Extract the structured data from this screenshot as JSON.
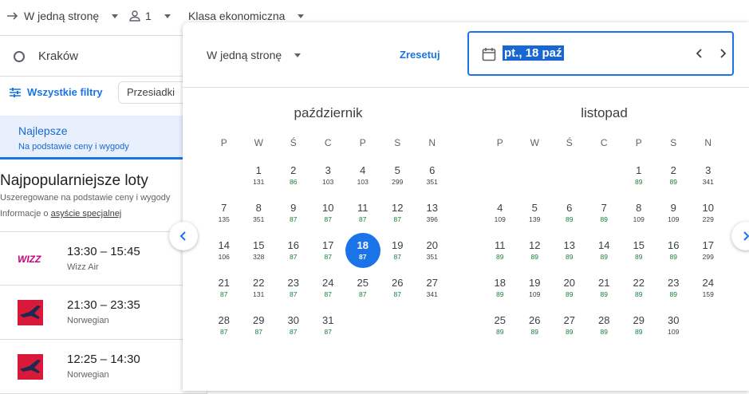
{
  "topbar": {
    "trip_type": "W jedną stronę",
    "passengers": "1",
    "cabin_class": "Klasa ekonomiczna"
  },
  "search": {
    "origin": "Kraków"
  },
  "filters": {
    "all_filters_label": "Wszystkie filtry",
    "stops_chip": "Przesiadki"
  },
  "sort_tab": {
    "title": "Najlepsze",
    "subtitle": "Na podstawie ceny i wygody"
  },
  "popular": {
    "title": "Najpopularniejsze loty",
    "subtitle": "Uszeregowane na podstawie ceny i wygody",
    "info_prefix": "Informacje o ",
    "info_link": "asyście specjalnej"
  },
  "flights": [
    {
      "time": "13:30 – 15:45",
      "airline": "Wizz Air",
      "logo": "wizz-logo"
    },
    {
      "time": "21:30 – 23:35",
      "airline": "Norwegian",
      "logo": "norwegian-logo"
    },
    {
      "time": "12:25 – 14:30",
      "airline": "Norwegian",
      "logo": "norwegian-logo"
    }
  ],
  "date_panel": {
    "trip_type": "W jedną stronę",
    "reset_label": "Zresetuj",
    "date_value": "pt., 18 paź",
    "weekdays": [
      "P",
      "W",
      "Ś",
      "C",
      "P",
      "S",
      "N"
    ],
    "months": [
      {
        "name": "październik",
        "offset": 1,
        "days": [
          {
            "d": "1",
            "p": "131"
          },
          {
            "d": "2",
            "p": "86",
            "low": true
          },
          {
            "d": "3",
            "p": "103"
          },
          {
            "d": "4",
            "p": "103"
          },
          {
            "d": "5",
            "p": "299"
          },
          {
            "d": "6",
            "p": "351"
          },
          {
            "d": "7",
            "p": "135"
          },
          {
            "d": "8",
            "p": "351"
          },
          {
            "d": "9",
            "p": "87",
            "low": true
          },
          {
            "d": "10",
            "p": "87",
            "low": true
          },
          {
            "d": "11",
            "p": "87",
            "low": true
          },
          {
            "d": "12",
            "p": "87",
            "low": true
          },
          {
            "d": "13",
            "p": "396"
          },
          {
            "d": "14",
            "p": "106"
          },
          {
            "d": "15",
            "p": "328"
          },
          {
            "d": "16",
            "p": "87",
            "low": true
          },
          {
            "d": "17",
            "p": "87",
            "low": true
          },
          {
            "d": "18",
            "p": "87",
            "selected": true
          },
          {
            "d": "19",
            "p": "87",
            "low": true
          },
          {
            "d": "20",
            "p": "351"
          },
          {
            "d": "21",
            "p": "87",
            "low": true
          },
          {
            "d": "22",
            "p": "131"
          },
          {
            "d": "23",
            "p": "87",
            "low": true
          },
          {
            "d": "24",
            "p": "87",
            "low": true
          },
          {
            "d": "25",
            "p": "87",
            "low": true
          },
          {
            "d": "26",
            "p": "87",
            "low": true
          },
          {
            "d": "27",
            "p": "341"
          },
          {
            "d": "28",
            "p": "87",
            "low": true
          },
          {
            "d": "29",
            "p": "87",
            "low": true
          },
          {
            "d": "30",
            "p": "87",
            "low": true
          },
          {
            "d": "31",
            "p": "87",
            "low": true
          }
        ]
      },
      {
        "name": "listopad",
        "offset": 4,
        "days": [
          {
            "d": "1",
            "p": "89",
            "low": true
          },
          {
            "d": "2",
            "p": "89",
            "low": true
          },
          {
            "d": "3",
            "p": "341"
          },
          {
            "d": "4",
            "p": "109"
          },
          {
            "d": "5",
            "p": "139"
          },
          {
            "d": "6",
            "p": "89",
            "low": true
          },
          {
            "d": "7",
            "p": "89",
            "low": true
          },
          {
            "d": "8",
            "p": "109"
          },
          {
            "d": "9",
            "p": "109"
          },
          {
            "d": "10",
            "p": "229"
          },
          {
            "d": "11",
            "p": "89",
            "low": true
          },
          {
            "d": "12",
            "p": "89",
            "low": true
          },
          {
            "d": "13",
            "p": "89",
            "low": true
          },
          {
            "d": "14",
            "p": "89",
            "low": true
          },
          {
            "d": "15",
            "p": "89",
            "low": true
          },
          {
            "d": "16",
            "p": "89",
            "low": true
          },
          {
            "d": "17",
            "p": "299"
          },
          {
            "d": "18",
            "p": "89",
            "low": true
          },
          {
            "d": "19",
            "p": "109"
          },
          {
            "d": "20",
            "p": "89",
            "low": true
          },
          {
            "d": "21",
            "p": "89",
            "low": true
          },
          {
            "d": "22",
            "p": "89",
            "low": true
          },
          {
            "d": "23",
            "p": "89",
            "low": true
          },
          {
            "d": "24",
            "p": "159"
          },
          {
            "d": "25",
            "p": "89",
            "low": true
          },
          {
            "d": "26",
            "p": "89",
            "low": true
          },
          {
            "d": "27",
            "p": "89",
            "low": true
          },
          {
            "d": "28",
            "p": "89",
            "low": true
          },
          {
            "d": "29",
            "p": "89",
            "low": true
          },
          {
            "d": "30",
            "p": "109"
          }
        ]
      }
    ]
  },
  "colors": {
    "accent": "#1a73e8",
    "low_price": "#188038",
    "selected_bg": "#1a73e8"
  }
}
